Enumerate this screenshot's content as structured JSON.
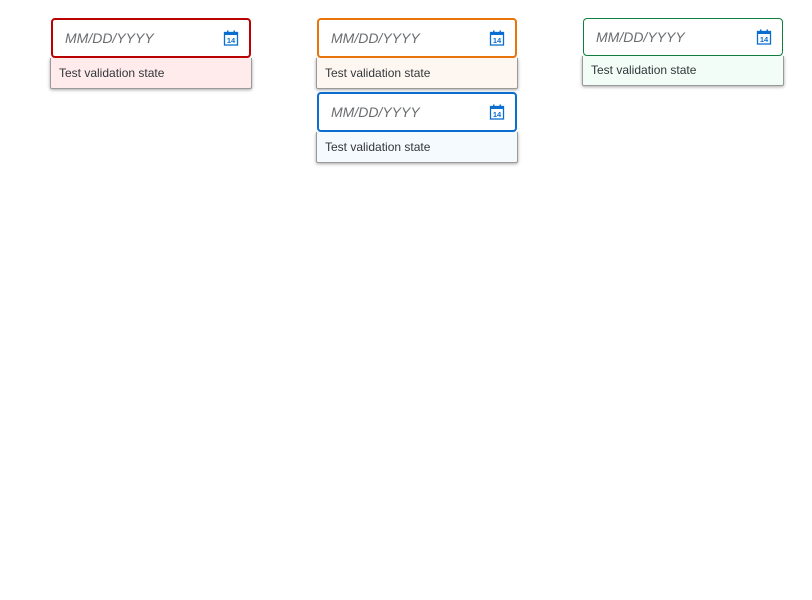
{
  "pickers": [
    {
      "state": "error",
      "placeholder": "MM/DD/YYYY",
      "value": "",
      "message": "Test validation state",
      "icon": "calendar-icon",
      "border_color": "#bb0000",
      "message_bg": "#ffebeb"
    },
    {
      "state": "warning",
      "placeholder": "MM/DD/YYYY",
      "value": "",
      "message": "Test validation state",
      "icon": "calendar-icon",
      "border_color": "#e9730c",
      "message_bg": "#fef7f1"
    },
    {
      "state": "success",
      "placeholder": "MM/DD/YYYY",
      "value": "",
      "message": "Test validation state",
      "icon": "calendar-icon",
      "border_color": "#107e3e",
      "message_bg": "#f1fdf6"
    },
    {
      "state": "information",
      "placeholder": "MM/DD/YYYY",
      "value": "",
      "message": "Test validation state",
      "icon": "calendar-icon",
      "border_color": "#0a6ed1",
      "message_bg": "#f5faff"
    }
  ],
  "calendar_icon": {
    "day": "14",
    "color": "#0a6ed1"
  }
}
